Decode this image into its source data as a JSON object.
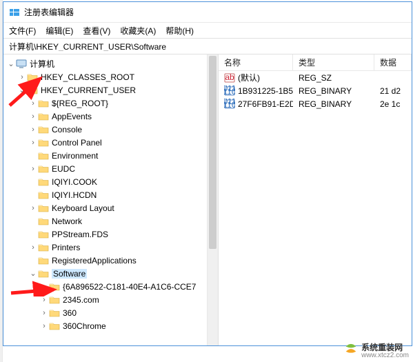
{
  "window": {
    "title": "注册表编辑器"
  },
  "menu": {
    "file": "文件(F)",
    "edit": "编辑(E)",
    "view": "查看(V)",
    "favorites": "收藏夹(A)",
    "help": "帮助(H)"
  },
  "address": {
    "path": "计算机\\HKEY_CURRENT_USER\\Software"
  },
  "columns": {
    "name": "名称",
    "type": "类型",
    "data": "数据"
  },
  "tree": {
    "root": "计算机",
    "nodes": [
      {
        "label": "HKEY_CLASSES_ROOT",
        "depth": 1,
        "exp": ">"
      },
      {
        "label": "HKEY_CURRENT_USER",
        "depth": 1,
        "exp": "v"
      },
      {
        "label": "${REG_ROOT}",
        "depth": 2,
        "exp": ">"
      },
      {
        "label": "AppEvents",
        "depth": 2,
        "exp": ">"
      },
      {
        "label": "Console",
        "depth": 2,
        "exp": ">"
      },
      {
        "label": "Control Panel",
        "depth": 2,
        "exp": ">"
      },
      {
        "label": "Environment",
        "depth": 2,
        "exp": ""
      },
      {
        "label": "EUDC",
        "depth": 2,
        "exp": ">"
      },
      {
        "label": "IQIYI.COOK",
        "depth": 2,
        "exp": ""
      },
      {
        "label": "IQIYI.HCDN",
        "depth": 2,
        "exp": ""
      },
      {
        "label": "Keyboard Layout",
        "depth": 2,
        "exp": ">"
      },
      {
        "label": "Network",
        "depth": 2,
        "exp": ""
      },
      {
        "label": "PPStream.FDS",
        "depth": 2,
        "exp": ""
      },
      {
        "label": "Printers",
        "depth": 2,
        "exp": ">"
      },
      {
        "label": "RegisteredApplications",
        "depth": 2,
        "exp": ""
      },
      {
        "label": "Software",
        "depth": 2,
        "exp": "v",
        "selected": true
      },
      {
        "label": "{6A896522-C181-40E4-A1C6-CCE7",
        "depth": 3,
        "exp": ">"
      },
      {
        "label": "2345.com",
        "depth": 3,
        "exp": ">"
      },
      {
        "label": "360",
        "depth": 3,
        "exp": ">"
      },
      {
        "label": "360Chrome",
        "depth": 3,
        "exp": ">"
      }
    ]
  },
  "values": [
    {
      "name": "(默认)",
      "type": "REG_SZ",
      "data": "",
      "icon": "sz"
    },
    {
      "name": "1B931225-1B5...",
      "type": "REG_BINARY",
      "data": "21 d2",
      "icon": "bin"
    },
    {
      "name": "27F6FB91-E2D...",
      "type": "REG_BINARY",
      "data": "2e 1c",
      "icon": "bin"
    }
  ],
  "watermark": {
    "text": "系统重装网",
    "url": "www.xtcz2.com"
  }
}
